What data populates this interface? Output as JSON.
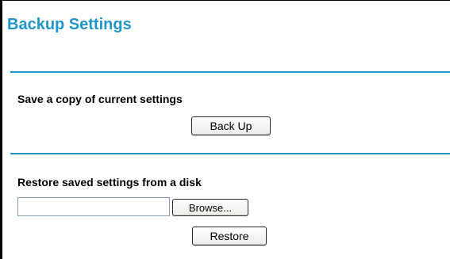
{
  "page": {
    "title": "Backup Settings"
  },
  "backup_section": {
    "heading": "Save a copy of current settings",
    "button_label": "Back Up"
  },
  "restore_section": {
    "heading": "Restore saved settings from a disk",
    "file_input_value": "",
    "browse_label": "Browse...",
    "restore_label": "Restore"
  },
  "colors": {
    "accent": "#1f96c9",
    "frame_border": "#000000",
    "input_border": "#7f9db9"
  }
}
